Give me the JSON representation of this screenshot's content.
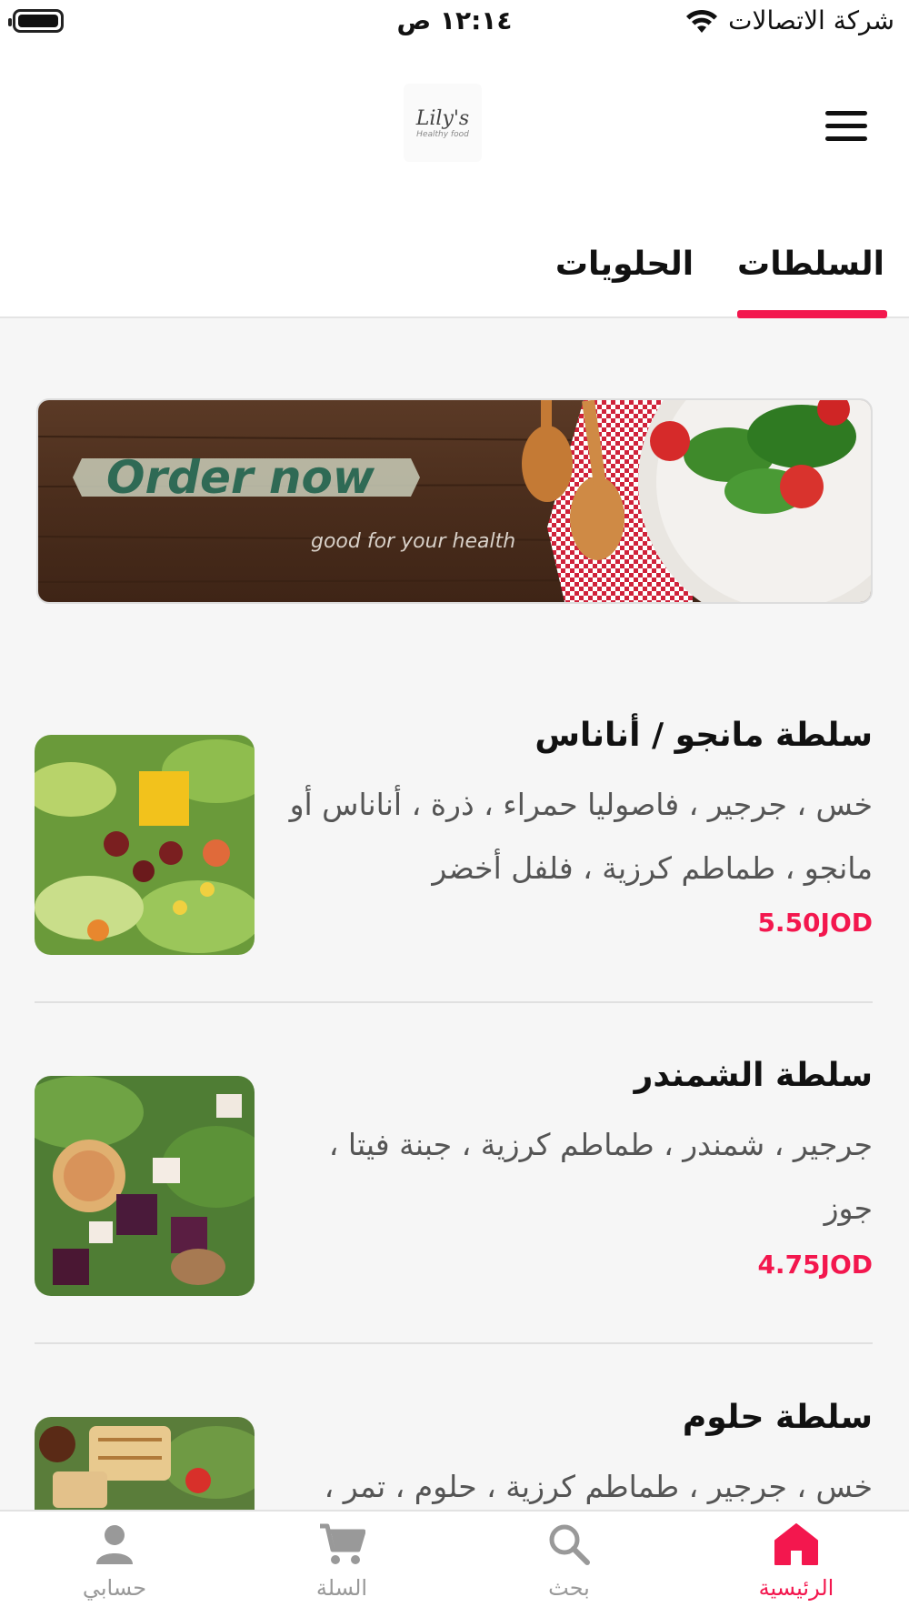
{
  "status_bar": {
    "time": "١٢:١٤ ص",
    "carrier": "شركة الاتصالات"
  },
  "header": {
    "logo_text": "Lily's",
    "logo_subtext": "Healthy food"
  },
  "tabs": [
    {
      "label": "السلطات",
      "active": true
    },
    {
      "label": "الحلويات",
      "active": false
    }
  ],
  "banner": {
    "headline": "Order now",
    "tagline": "good for your health"
  },
  "items": [
    {
      "title": "سلطة مانجو / أناناس",
      "description": "خس ، جرجير ، فاصوليا حمراء ، ذرة ، أناناس أو مانجو ، طماطم كرزية ، فلفل أخضر",
      "price": "5.50JOD"
    },
    {
      "title": "سلطة الشمندر",
      "description": "جرجير ، شمندر ، طماطم كرزية ، جبنة فيتا ، جوز",
      "price": "4.75JOD"
    },
    {
      "title": "سلطة حلوم",
      "description": "خس ، جرجير ، طماطم كرزية ، حلوم ، تمر ،",
      "price": ""
    }
  ],
  "bottom_nav": [
    {
      "label": "حسابي",
      "icon": "person-icon",
      "active": false
    },
    {
      "label": "السلة",
      "icon": "cart-icon",
      "active": false
    },
    {
      "label": "بحث",
      "icon": "search-icon",
      "active": false
    },
    {
      "label": "الرئيسية",
      "icon": "home-icon",
      "active": true
    }
  ],
  "colors": {
    "accent": "#f3174e",
    "price": "#f3174e"
  }
}
